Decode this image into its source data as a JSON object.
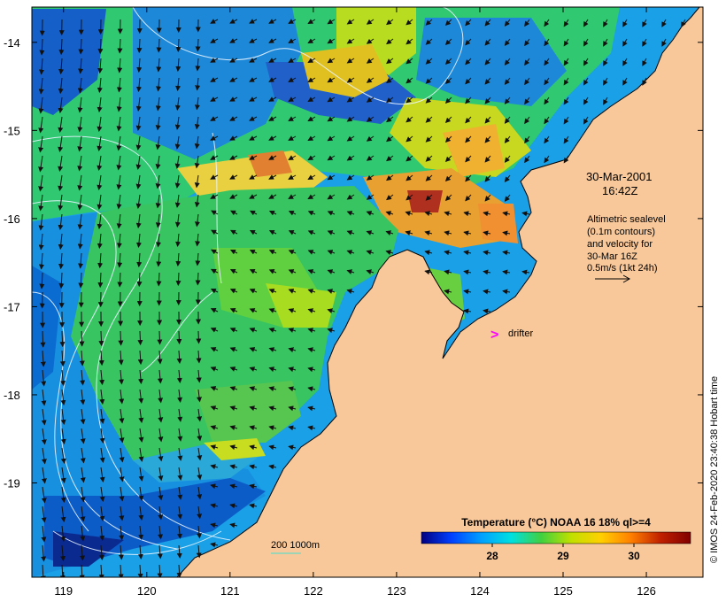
{
  "map": {
    "lon_range": [
      118.62,
      126.68
    ],
    "lat_range": [
      -20.07,
      -13.6
    ],
    "lon_ticks": [
      119,
      120,
      121,
      122,
      123,
      124,
      125,
      126
    ],
    "lat_ticks": [
      -14,
      -15,
      -16,
      -17,
      -18,
      -19
    ],
    "lon_tick_labels": [
      "119",
      "120",
      "121",
      "122",
      "123",
      "124",
      "125",
      "126"
    ],
    "lat_tick_labels": [
      "-14",
      "-15",
      "-16",
      "-17",
      "-18",
      "-19"
    ],
    "colors": {
      "land": "#f8c89a",
      "coastline": "#000000",
      "contour": "#e8f4ff",
      "vector": "#111111",
      "drifter": "#ff00ff",
      "depth_contour": "#40e0d0"
    }
  },
  "annotation": {
    "date": "30-Mar-2001",
    "time": "16:42Z",
    "legend_lines": [
      "Altimetric sealevel",
      "(0.1m contours)",
      "and velocity for",
      "30-Mar 16Z",
      "0.5m/s (1kt 24h)"
    ],
    "drifter_label": "drifter",
    "drifter_marker": ">",
    "bathymetry_label": "200  1000m"
  },
  "colorbar": {
    "title": "Temperature (°C) NOAA 16 18% ql>=4",
    "tick_labels": [
      "28",
      "29",
      "30"
    ],
    "ticks": [
      28,
      29,
      30
    ],
    "range": [
      27.0,
      30.8
    ],
    "stops": [
      "#000080",
      "#0040ff",
      "#00a0ff",
      "#00e0e0",
      "#40d040",
      "#c0e000",
      "#ffd000",
      "#ff8000",
      "#c02000",
      "#800000"
    ]
  },
  "credit": "© IMOS 24-Feb-2020 23:40:38 Hobart time"
}
